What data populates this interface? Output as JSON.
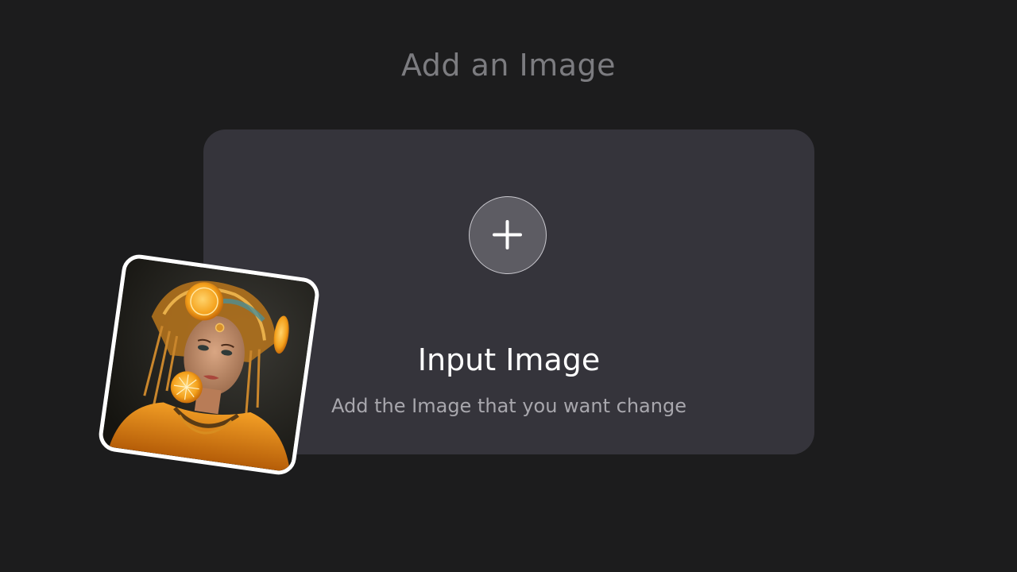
{
  "page": {
    "title": "Add an Image"
  },
  "upload": {
    "title": "Input Image",
    "subtitle": "Add the Image that you want change",
    "add_icon": "plus-icon"
  },
  "sample_image": {
    "description_icon": "portrait-photo"
  },
  "colors": {
    "background": "#1c1c1d",
    "card": "#35343b",
    "button": "#5d5c63",
    "accent": "#f29a1c"
  }
}
